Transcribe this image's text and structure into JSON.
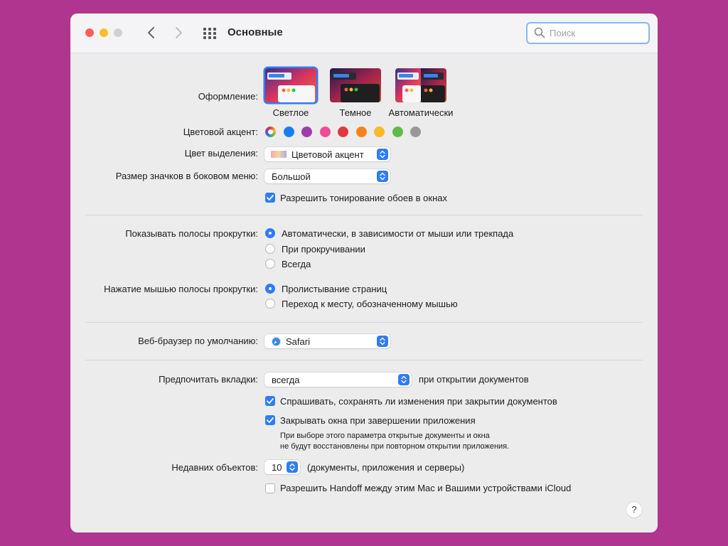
{
  "window": {
    "title": "Основные"
  },
  "search": {
    "placeholder": "Поиск"
  },
  "appearance": {
    "label": "Оформление:",
    "options": [
      {
        "label": "Светлое",
        "selected": true
      },
      {
        "label": "Темное",
        "selected": false
      },
      {
        "label": "Автоматически",
        "selected": false
      }
    ]
  },
  "accent": {
    "label": "Цветовой акцент:",
    "colors": [
      "multicolor",
      "#1a7cf5",
      "#9b3fa6",
      "#f14b98",
      "#e0383e",
      "#f7821b",
      "#fcb827",
      "#62ba46",
      "#989898"
    ]
  },
  "highlight": {
    "label": "Цвет выделения:",
    "value": "Цветовой акцент"
  },
  "sidebar_icon_size": {
    "label": "Размер значков в боковом меню:",
    "value": "Большой"
  },
  "wallpaper_tinting": {
    "label": "Разрешить тонирование обоев в окнах",
    "checked": true
  },
  "scrollbars": {
    "label": "Показывать полосы прокрутки:",
    "options": [
      {
        "label": "Автоматически, в зависимости от мыши или трекпада",
        "selected": true
      },
      {
        "label": "При прокручивании",
        "selected": false
      },
      {
        "label": "Всегда",
        "selected": false
      }
    ]
  },
  "scroll_click": {
    "label": "Нажатие мышью полосы прокрутки:",
    "options": [
      {
        "label": "Пролистывание страниц",
        "selected": true
      },
      {
        "label": "Переход к месту, обозначенному мышью",
        "selected": false
      }
    ]
  },
  "browser": {
    "label": "Веб-браузер по умолчанию:",
    "value": "Safari"
  },
  "tabs": {
    "label": "Предпочитать вкладки:",
    "value": "всегда",
    "suffix": "при открытии документов"
  },
  "ask_save": {
    "label": "Спрашивать, сохранять ли изменения при закрытии документов",
    "checked": true
  },
  "close_windows": {
    "label": "Закрывать окна при завершении приложения",
    "checked": true,
    "note_line1": "При выборе этого параметра открытые документы и окна",
    "note_line2": "не будут восстановлены при повторном открытии приложения."
  },
  "recent": {
    "label": "Недавних объектов:",
    "value": "10",
    "suffix": "(документы, приложения и серверы)"
  },
  "handoff": {
    "label": "Разрешить Handoff между этим Mac и Вашими устройствами iCloud",
    "checked": false
  },
  "help": {
    "label": "?"
  }
}
